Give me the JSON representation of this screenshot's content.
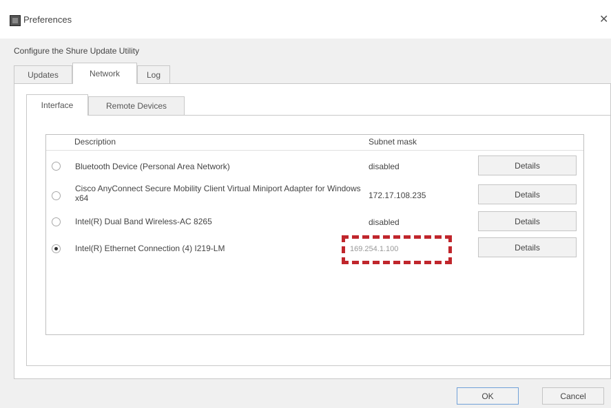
{
  "window": {
    "title": "Preferences",
    "close_glyph": "✕"
  },
  "subtitle": "Configure the Shure Update Utility",
  "outer_tabs": [
    {
      "label": "Updates"
    },
    {
      "label": "Network"
    },
    {
      "label": "Log"
    }
  ],
  "inner_tabs": [
    {
      "label": "Interface"
    },
    {
      "label": "Remote Devices"
    }
  ],
  "columns": {
    "description": "Description",
    "subnet_mask": "Subnet mask"
  },
  "interfaces": [
    {
      "description": "Bluetooth Device (Personal Area Network)",
      "subnet_mask": "disabled",
      "button": "Details",
      "selected": false
    },
    {
      "description": "Cisco AnyConnect Secure Mobility Client Virtual Miniport Adapter for Windows x64",
      "subnet_mask": "172.17.108.235",
      "button": "Details",
      "selected": false
    },
    {
      "description": "Intel(R) Dual Band Wireless-AC 8265",
      "subnet_mask": "disabled",
      "button": "Details",
      "selected": false
    },
    {
      "description": "Intel(R) Ethernet Connection (4) I219-LM",
      "subnet_mask": "169.254.1.100",
      "button": "Details",
      "selected": true
    }
  ],
  "footer": {
    "ok": "OK",
    "cancel": "Cancel"
  },
  "colors": {
    "highlight": "#c0262c"
  }
}
